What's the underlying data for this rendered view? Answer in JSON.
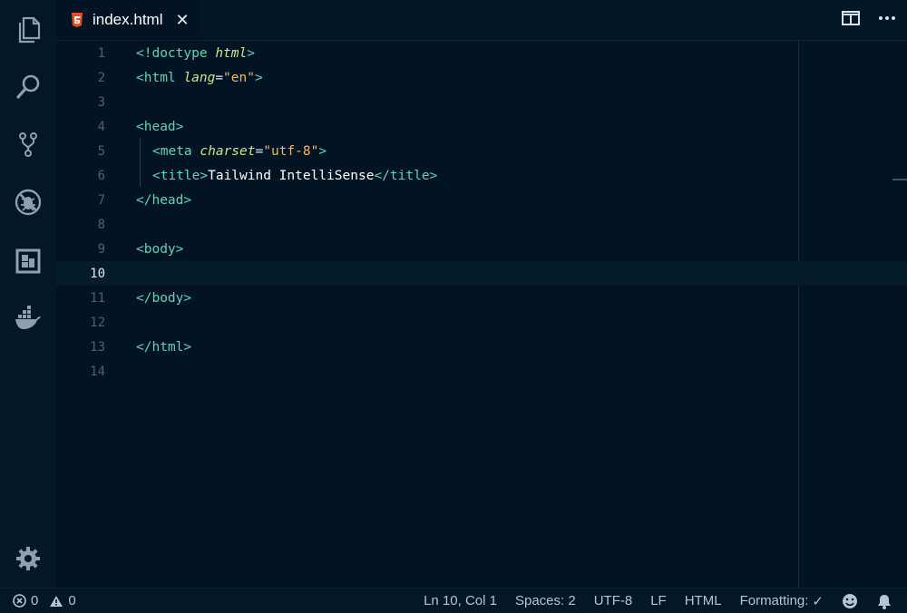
{
  "activity_bar": {
    "items": [
      {
        "name": "explorer-icon"
      },
      {
        "name": "search-icon"
      },
      {
        "name": "source-control-icon"
      },
      {
        "name": "debug-icon"
      },
      {
        "name": "extensions-icon"
      },
      {
        "name": "docker-icon"
      }
    ],
    "settings": "gear-icon"
  },
  "tab": {
    "label": "index.html",
    "icon": "html5-icon",
    "close": "✕"
  },
  "tab_actions": [
    "split-editor-icon",
    "more-actions-icon"
  ],
  "editor": {
    "current_line": 10,
    "line_numbers": [
      "1",
      "2",
      "3",
      "4",
      "5",
      "6",
      "7",
      "8",
      "9",
      "10",
      "11",
      "12",
      "13",
      "14"
    ],
    "lines": {
      "l1": {
        "open": "<!doctype ",
        "attr": "html",
        "close": ">"
      },
      "l2": {
        "open": "<html ",
        "attr": "lang",
        "eq": "=",
        "val": "\"en\"",
        "close": ">"
      },
      "l4": {
        "tag": "<head>"
      },
      "l5": {
        "open": "<meta ",
        "attr": "charset",
        "eq": "=",
        "val": "\"utf-8\"",
        "close": ">"
      },
      "l6": {
        "open": "<title>",
        "text": "Tailwind IntelliSense",
        "close": "</title>"
      },
      "l7": {
        "tag": "</head>"
      },
      "l9": {
        "tag": "<body>"
      },
      "l11": {
        "tag": "</body>"
      },
      "l13": {
        "tag": "</html>"
      }
    }
  },
  "status_bar": {
    "errors": "0",
    "warnings": "0",
    "position": "Ln 10, Col 1",
    "spaces": "Spaces: 2",
    "encoding": "UTF-8",
    "eol": "LF",
    "language": "HTML",
    "formatting": "Formatting:",
    "formatting_check": "✓"
  },
  "colors": {
    "background": "#021323",
    "tag": "#5fd4b8",
    "attribute": "#c3e88d",
    "string": "#f7b955",
    "html5": "#e44d26"
  }
}
